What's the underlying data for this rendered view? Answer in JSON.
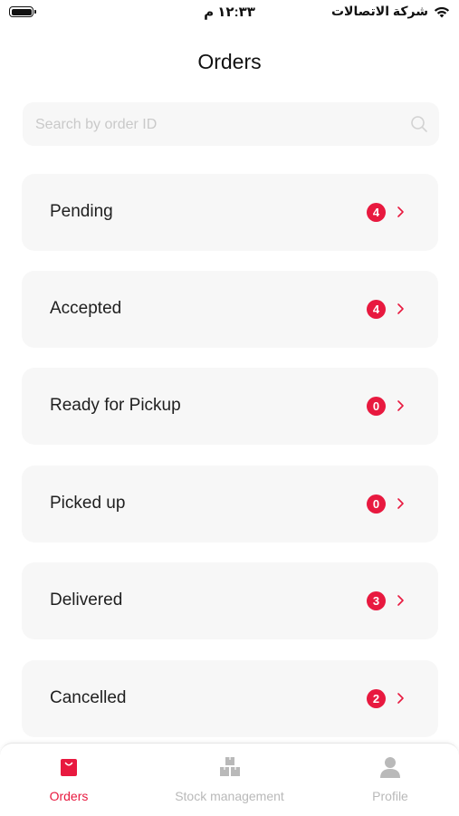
{
  "status_bar": {
    "time": "١٢:٣٣ م",
    "carrier": "شركة الاتصالات"
  },
  "header": {
    "title": "Orders"
  },
  "search": {
    "placeholder": "Search by order ID",
    "value": ""
  },
  "order_statuses": [
    {
      "label": "Pending",
      "count": "4"
    },
    {
      "label": "Accepted",
      "count": "4"
    },
    {
      "label": "Ready for Pickup",
      "count": "0"
    },
    {
      "label": "Picked up",
      "count": "0"
    },
    {
      "label": "Delivered",
      "count": "3"
    },
    {
      "label": "Cancelled",
      "count": "2"
    }
  ],
  "tabbar": {
    "items": [
      {
        "label": "Orders",
        "icon": "shopping-bag-icon",
        "active": true
      },
      {
        "label": "Stock management",
        "icon": "boxes-icon",
        "active": false
      },
      {
        "label": "Profile",
        "icon": "person-icon",
        "active": false
      }
    ]
  },
  "colors": {
    "accent": "#e8193f",
    "card_bg": "#f7f7f7",
    "inactive": "#b9b9b9"
  }
}
